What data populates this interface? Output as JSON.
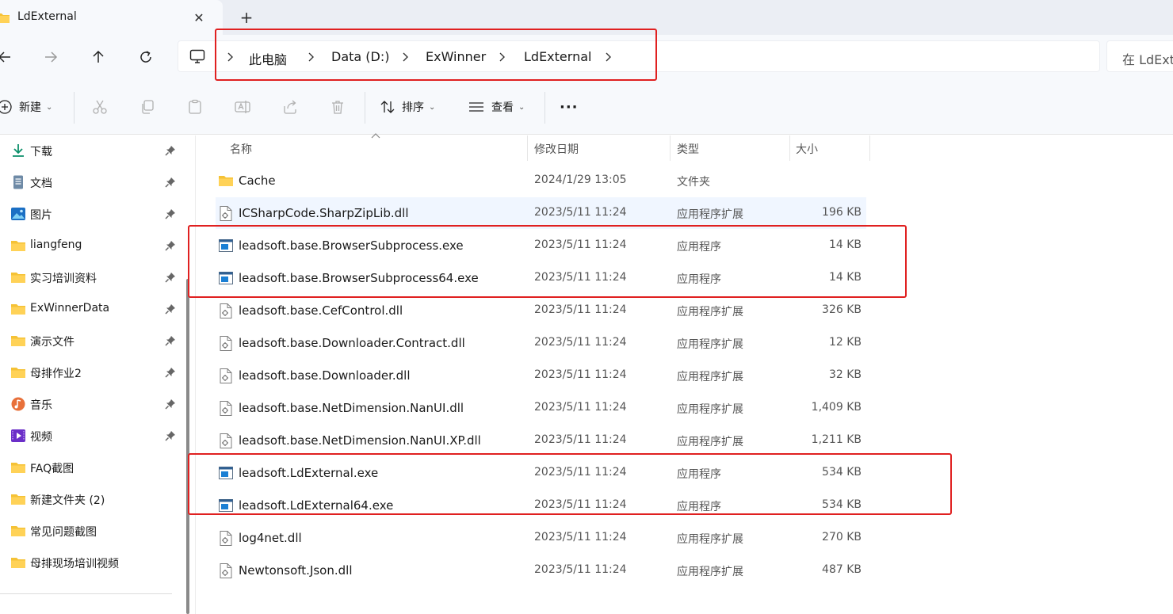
{
  "tab": {
    "title": "LdExternal",
    "close_label": "✕",
    "new_tab_label": "+"
  },
  "address": {
    "crumbs": [
      "此电脑",
      "Data (D:)",
      "ExWinner",
      "LdExternal"
    ],
    "search_placeholder": "在 LdExt"
  },
  "toolbar": {
    "new_label": "新建",
    "sort_label": "排序",
    "view_label": "查看",
    "more_label": "···"
  },
  "sidebar": {
    "items": [
      {
        "label": "下载",
        "icon": "download-icon",
        "pinned": true
      },
      {
        "label": "文档",
        "icon": "document-icon",
        "pinned": true
      },
      {
        "label": "图片",
        "icon": "pictures-icon",
        "pinned": true
      },
      {
        "label": "liangfeng",
        "icon": "folder-icon",
        "pinned": true
      },
      {
        "label": "实习培训资料",
        "icon": "folder-icon",
        "pinned": true
      },
      {
        "label": "ExWinnerData",
        "icon": "folder-icon",
        "pinned": true
      },
      {
        "label": "演示文件",
        "icon": "folder-icon",
        "pinned": true
      },
      {
        "label": "母排作业2",
        "icon": "folder-icon",
        "pinned": true
      },
      {
        "label": "音乐",
        "icon": "music-icon",
        "pinned": true
      },
      {
        "label": "视频",
        "icon": "video-icon",
        "pinned": true
      },
      {
        "label": "FAQ截图",
        "icon": "folder-icon",
        "pinned": false
      },
      {
        "label": "新建文件夹 (2)",
        "icon": "folder-icon",
        "pinned": false
      },
      {
        "label": "常见问题截图",
        "icon": "folder-icon",
        "pinned": false
      },
      {
        "label": "母排现场培训视频",
        "icon": "folder-icon",
        "pinned": false
      }
    ]
  },
  "filelist": {
    "columns": {
      "name": "名称",
      "date": "修改日期",
      "type": "类型",
      "size": "大小"
    },
    "rows": [
      {
        "name": "Cache",
        "date": "2024/1/29 13:05",
        "type": "文件夹",
        "size": "",
        "icon": "folder-icon"
      },
      {
        "name": "ICSharpCode.SharpZipLib.dll",
        "date": "2023/5/11 11:24",
        "type": "应用程序扩展",
        "size": "196 KB",
        "icon": "dll-file-icon"
      },
      {
        "name": "leadsoft.base.BrowserSubprocess.exe",
        "date": "2023/5/11 11:24",
        "type": "应用程序",
        "size": "14 KB",
        "icon": "exe-file-icon"
      },
      {
        "name": "leadsoft.base.BrowserSubprocess64.exe",
        "date": "2023/5/11 11:24",
        "type": "应用程序",
        "size": "14 KB",
        "icon": "exe-file-icon"
      },
      {
        "name": "leadsoft.base.CefControl.dll",
        "date": "2023/5/11 11:24",
        "type": "应用程序扩展",
        "size": "326 KB",
        "icon": "dll-file-icon"
      },
      {
        "name": "leadsoft.base.Downloader.Contract.dll",
        "date": "2023/5/11 11:24",
        "type": "应用程序扩展",
        "size": "12 KB",
        "icon": "dll-file-icon"
      },
      {
        "name": "leadsoft.base.Downloader.dll",
        "date": "2023/5/11 11:24",
        "type": "应用程序扩展",
        "size": "32 KB",
        "icon": "dll-file-icon"
      },
      {
        "name": "leadsoft.base.NetDimension.NanUI.dll",
        "date": "2023/5/11 11:24",
        "type": "应用程序扩展",
        "size": "1,409 KB",
        "icon": "dll-file-icon"
      },
      {
        "name": "leadsoft.base.NetDimension.NanUI.XP.dll",
        "date": "2023/5/11 11:24",
        "type": "应用程序扩展",
        "size": "1,211 KB",
        "icon": "dll-file-icon"
      },
      {
        "name": "leadsoft.LdExternal.exe",
        "date": "2023/5/11 11:24",
        "type": "应用程序",
        "size": "534 KB",
        "icon": "exe-file-icon"
      },
      {
        "name": "leadsoft.LdExternal64.exe",
        "date": "2023/5/11 11:24",
        "type": "应用程序",
        "size": "534 KB",
        "icon": "exe-file-icon"
      },
      {
        "name": "log4net.dll",
        "date": "2023/5/11 11:24",
        "type": "应用程序扩展",
        "size": "270 KB",
        "icon": "dll-file-icon"
      },
      {
        "name": "Newtonsoft.Json.dll",
        "date": "2023/5/11 11:24",
        "type": "应用程序扩展",
        "size": "487 KB",
        "icon": "dll-file-icon"
      }
    ]
  },
  "colors": {
    "highlight_box": "#e02020",
    "folder": "#f5c236",
    "accent": "#0067c0"
  }
}
